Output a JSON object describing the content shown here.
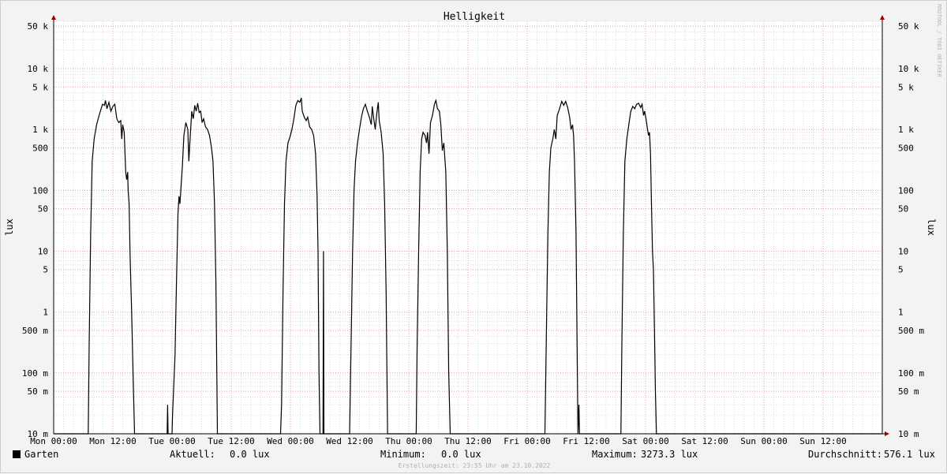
{
  "chart_data": {
    "type": "line",
    "title": "Helligkeit",
    "ylabel": "lux",
    "y_scale": "log",
    "ylim": [
      0.01,
      60000
    ],
    "grid": true,
    "watermark": "RRDTOOL / TOBI OETIKER",
    "yticks": [
      {
        "v": 50000,
        "label": "50 k"
      },
      {
        "v": 10000,
        "label": "10 k"
      },
      {
        "v": 5000,
        "label": "5 k"
      },
      {
        "v": 1000,
        "label": "1 k"
      },
      {
        "v": 500,
        "label": "500"
      },
      {
        "v": 100,
        "label": "100"
      },
      {
        "v": 50,
        "label": "50"
      },
      {
        "v": 10,
        "label": "10"
      },
      {
        "v": 5,
        "label": "5"
      },
      {
        "v": 1,
        "label": "1"
      },
      {
        "v": 0.5,
        "label": "500 m"
      },
      {
        "v": 0.1,
        "label": "100 m"
      },
      {
        "v": 0.05,
        "label": "50 m"
      },
      {
        "v": 0.01,
        "label": "10 m"
      }
    ],
    "x_range_hours": [
      0,
      168
    ],
    "xticks": [
      {
        "h": 0,
        "label": "Mon 00:00"
      },
      {
        "h": 12,
        "label": "Mon 12:00"
      },
      {
        "h": 24,
        "label": "Tue 00:00"
      },
      {
        "h": 36,
        "label": "Tue 12:00"
      },
      {
        "h": 48,
        "label": "Wed 00:00"
      },
      {
        "h": 60,
        "label": "Wed 12:00"
      },
      {
        "h": 72,
        "label": "Thu 00:00"
      },
      {
        "h": 84,
        "label": "Thu 12:00"
      },
      {
        "h": 96,
        "label": "Fri 00:00"
      },
      {
        "h": 108,
        "label": "Fri 12:00"
      },
      {
        "h": 120,
        "label": "Sat 00:00"
      },
      {
        "h": 132,
        "label": "Sat 12:00"
      },
      {
        "h": 144,
        "label": "Sun 00:00"
      },
      {
        "h": 156,
        "label": "Sun 12:00"
      }
    ],
    "series": [
      {
        "name": "Garten",
        "color": "#000000",
        "points": [
          [
            0,
            0.01
          ],
          [
            7.0,
            0.01
          ],
          [
            7.2,
            0.3
          ],
          [
            7.5,
            20
          ],
          [
            7.8,
            300
          ],
          [
            8.2,
            700
          ],
          [
            8.7,
            1200
          ],
          [
            9.3,
            1800
          ],
          [
            9.9,
            2600
          ],
          [
            10.3,
            2500
          ],
          [
            10.5,
            3000
          ],
          [
            10.8,
            2200
          ],
          [
            11.2,
            2800
          ],
          [
            11.6,
            2000
          ],
          [
            12.0,
            2400
          ],
          [
            12.4,
            2600
          ],
          [
            12.8,
            1500
          ],
          [
            13.2,
            1300
          ],
          [
            13.6,
            1400
          ],
          [
            13.8,
            700
          ],
          [
            14.0,
            1200
          ],
          [
            14.3,
            900
          ],
          [
            14.6,
            200
          ],
          [
            14.8,
            150
          ],
          [
            15.0,
            200
          ],
          [
            15.1,
            100
          ],
          [
            15.3,
            60
          ],
          [
            15.5,
            8
          ],
          [
            15.8,
            1
          ],
          [
            16.1,
            0.1
          ],
          [
            16.4,
            0.01
          ],
          [
            23.0,
            0.01
          ],
          [
            23.1,
            0.03
          ],
          [
            23.2,
            0.01
          ],
          [
            24.0,
            0.01
          ],
          [
            24.1,
            0.02
          ],
          [
            24.3,
            0.05
          ],
          [
            24.6,
            0.2
          ],
          [
            24.9,
            3
          ],
          [
            25.2,
            40
          ],
          [
            25.4,
            80
          ],
          [
            25.6,
            60
          ],
          [
            25.8,
            110
          ],
          [
            26.1,
            250
          ],
          [
            26.4,
            800
          ],
          [
            26.8,
            1300
          ],
          [
            27.2,
            1000
          ],
          [
            27.4,
            300
          ],
          [
            27.7,
            800
          ],
          [
            28.0,
            2000
          ],
          [
            28.3,
            1500
          ],
          [
            28.6,
            2500
          ],
          [
            28.9,
            2000
          ],
          [
            29.2,
            2700
          ],
          [
            29.5,
            1900
          ],
          [
            29.8,
            2000
          ],
          [
            30.1,
            1300
          ],
          [
            30.4,
            1500
          ],
          [
            30.8,
            1100
          ],
          [
            31.2,
            1000
          ],
          [
            31.6,
            800
          ],
          [
            32.0,
            500
          ],
          [
            32.3,
            300
          ],
          [
            32.6,
            60
          ],
          [
            32.9,
            3
          ],
          [
            33.2,
            0.01
          ],
          [
            46.0,
            0.01
          ],
          [
            46.2,
            0.03
          ],
          [
            46.5,
            2
          ],
          [
            46.8,
            60
          ],
          [
            47.1,
            300
          ],
          [
            47.5,
            600
          ],
          [
            47.9,
            750
          ],
          [
            48.3,
            1000
          ],
          [
            48.7,
            1500
          ],
          [
            49.1,
            2500
          ],
          [
            49.5,
            3000
          ],
          [
            49.9,
            2800
          ],
          [
            50.2,
            3300
          ],
          [
            50.4,
            2000
          ],
          [
            50.8,
            1600
          ],
          [
            51.2,
            1400
          ],
          [
            51.5,
            1600
          ],
          [
            51.9,
            1100
          ],
          [
            52.3,
            1000
          ],
          [
            52.7,
            800
          ],
          [
            53.1,
            400
          ],
          [
            53.4,
            80
          ],
          [
            53.6,
            10
          ],
          [
            53.8,
            0.1
          ],
          [
            54.0,
            0.01
          ],
          [
            54.6,
            0.01
          ],
          [
            54.7,
            10
          ],
          [
            54.8,
            0.01
          ],
          [
            60.0,
            0.01
          ],
          [
            60.3,
            0.3
          ],
          [
            60.6,
            10
          ],
          [
            60.9,
            100
          ],
          [
            61.2,
            300
          ],
          [
            61.6,
            600
          ],
          [
            62.0,
            1000
          ],
          [
            62.4,
            1600
          ],
          [
            62.8,
            2200
          ],
          [
            63.2,
            2600
          ],
          [
            63.6,
            2000
          ],
          [
            64.0,
            1600
          ],
          [
            64.4,
            1200
          ],
          [
            64.6,
            2400
          ],
          [
            64.9,
            1500
          ],
          [
            65.2,
            1000
          ],
          [
            65.5,
            1800
          ],
          [
            65.8,
            2800
          ],
          [
            66.0,
            1400
          ],
          [
            66.4,
            900
          ],
          [
            66.8,
            400
          ],
          [
            67.1,
            60
          ],
          [
            67.4,
            2
          ],
          [
            67.7,
            0.01
          ],
          [
            72.0,
            0.01
          ],
          [
            73.5,
            0.01
          ],
          [
            73.7,
            0.3
          ],
          [
            74.0,
            10
          ],
          [
            74.3,
            200
          ],
          [
            74.6,
            700
          ],
          [
            74.9,
            900
          ],
          [
            75.3,
            800
          ],
          [
            75.6,
            600
          ],
          [
            75.8,
            900
          ],
          [
            76.1,
            400
          ],
          [
            76.4,
            1300
          ],
          [
            76.8,
            1700
          ],
          [
            77.2,
            2600
          ],
          [
            77.5,
            3000
          ],
          [
            77.8,
            2200
          ],
          [
            78.2,
            2000
          ],
          [
            78.5,
            1200
          ],
          [
            78.8,
            450
          ],
          [
            79.1,
            600
          ],
          [
            79.5,
            200
          ],
          [
            79.8,
            10
          ],
          [
            80.1,
            0.1
          ],
          [
            80.4,
            0.01
          ],
          [
            96.0,
            0.01
          ],
          [
            99.6,
            0.01
          ],
          [
            99.9,
            0.5
          ],
          [
            100.2,
            20
          ],
          [
            100.5,
            200
          ],
          [
            100.8,
            500
          ],
          [
            101.2,
            700
          ],
          [
            101.5,
            1000
          ],
          [
            101.8,
            700
          ],
          [
            102.1,
            1700
          ],
          [
            102.4,
            2000
          ],
          [
            102.7,
            2400
          ],
          [
            103.0,
            2900
          ],
          [
            103.4,
            2500
          ],
          [
            103.8,
            2900
          ],
          [
            104.2,
            2300
          ],
          [
            104.6,
            1600
          ],
          [
            104.9,
            1000
          ],
          [
            105.2,
            1200
          ],
          [
            105.4,
            800
          ],
          [
            105.6,
            300
          ],
          [
            105.9,
            20
          ],
          [
            106.1,
            0.5
          ],
          [
            106.3,
            0.01
          ],
          [
            106.5,
            0.03
          ],
          [
            106.6,
            0.01
          ],
          [
            108.0,
            0.01
          ],
          [
            115.0,
            0.01
          ],
          [
            115.2,
            0.3
          ],
          [
            115.5,
            20
          ],
          [
            115.8,
            300
          ],
          [
            116.2,
            700
          ],
          [
            116.6,
            1200
          ],
          [
            117.0,
            2000
          ],
          [
            117.4,
            2400
          ],
          [
            117.8,
            2200
          ],
          [
            118.2,
            2600
          ],
          [
            118.6,
            2700
          ],
          [
            119.0,
            2300
          ],
          [
            119.3,
            2600
          ],
          [
            119.6,
            1700
          ],
          [
            119.8,
            2000
          ],
          [
            120.1,
            1500
          ],
          [
            120.4,
            1000
          ],
          [
            120.6,
            800
          ],
          [
            120.8,
            900
          ],
          [
            121.0,
            400
          ],
          [
            121.2,
            60
          ],
          [
            121.4,
            10
          ],
          [
            121.6,
            5
          ],
          [
            121.8,
            0.5
          ],
          [
            122.0,
            0.05
          ],
          [
            122.2,
            0.01
          ],
          [
            168,
            0.01
          ]
        ]
      }
    ]
  },
  "legend": {
    "series_name": "Garten",
    "aktuell_label": "Aktuell:",
    "aktuell_value": "0.0 lux",
    "minimum_label": "Minimum:",
    "minimum_value": "0.0 lux",
    "maximum_label": "Maximum:",
    "maximum_value": "3273.3 lux",
    "avg_label": "Durchschnitt:",
    "avg_value": "576.1 lux",
    "footer": "Erstellungszeit: 23:55 Uhr am 23.10.2022"
  }
}
